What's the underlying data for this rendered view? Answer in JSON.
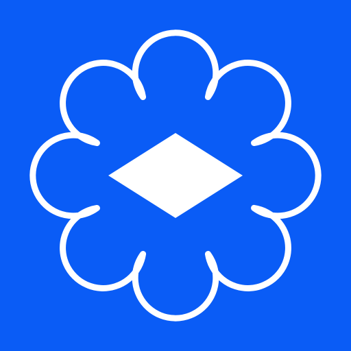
{
  "icon": {
    "name": "scalloped-badge-diamond-icon",
    "background_color": "#0A5CF6",
    "outline_color": "#FFFFFF",
    "diamond_color": "#FFFFFF",
    "scallop_count": 8
  }
}
